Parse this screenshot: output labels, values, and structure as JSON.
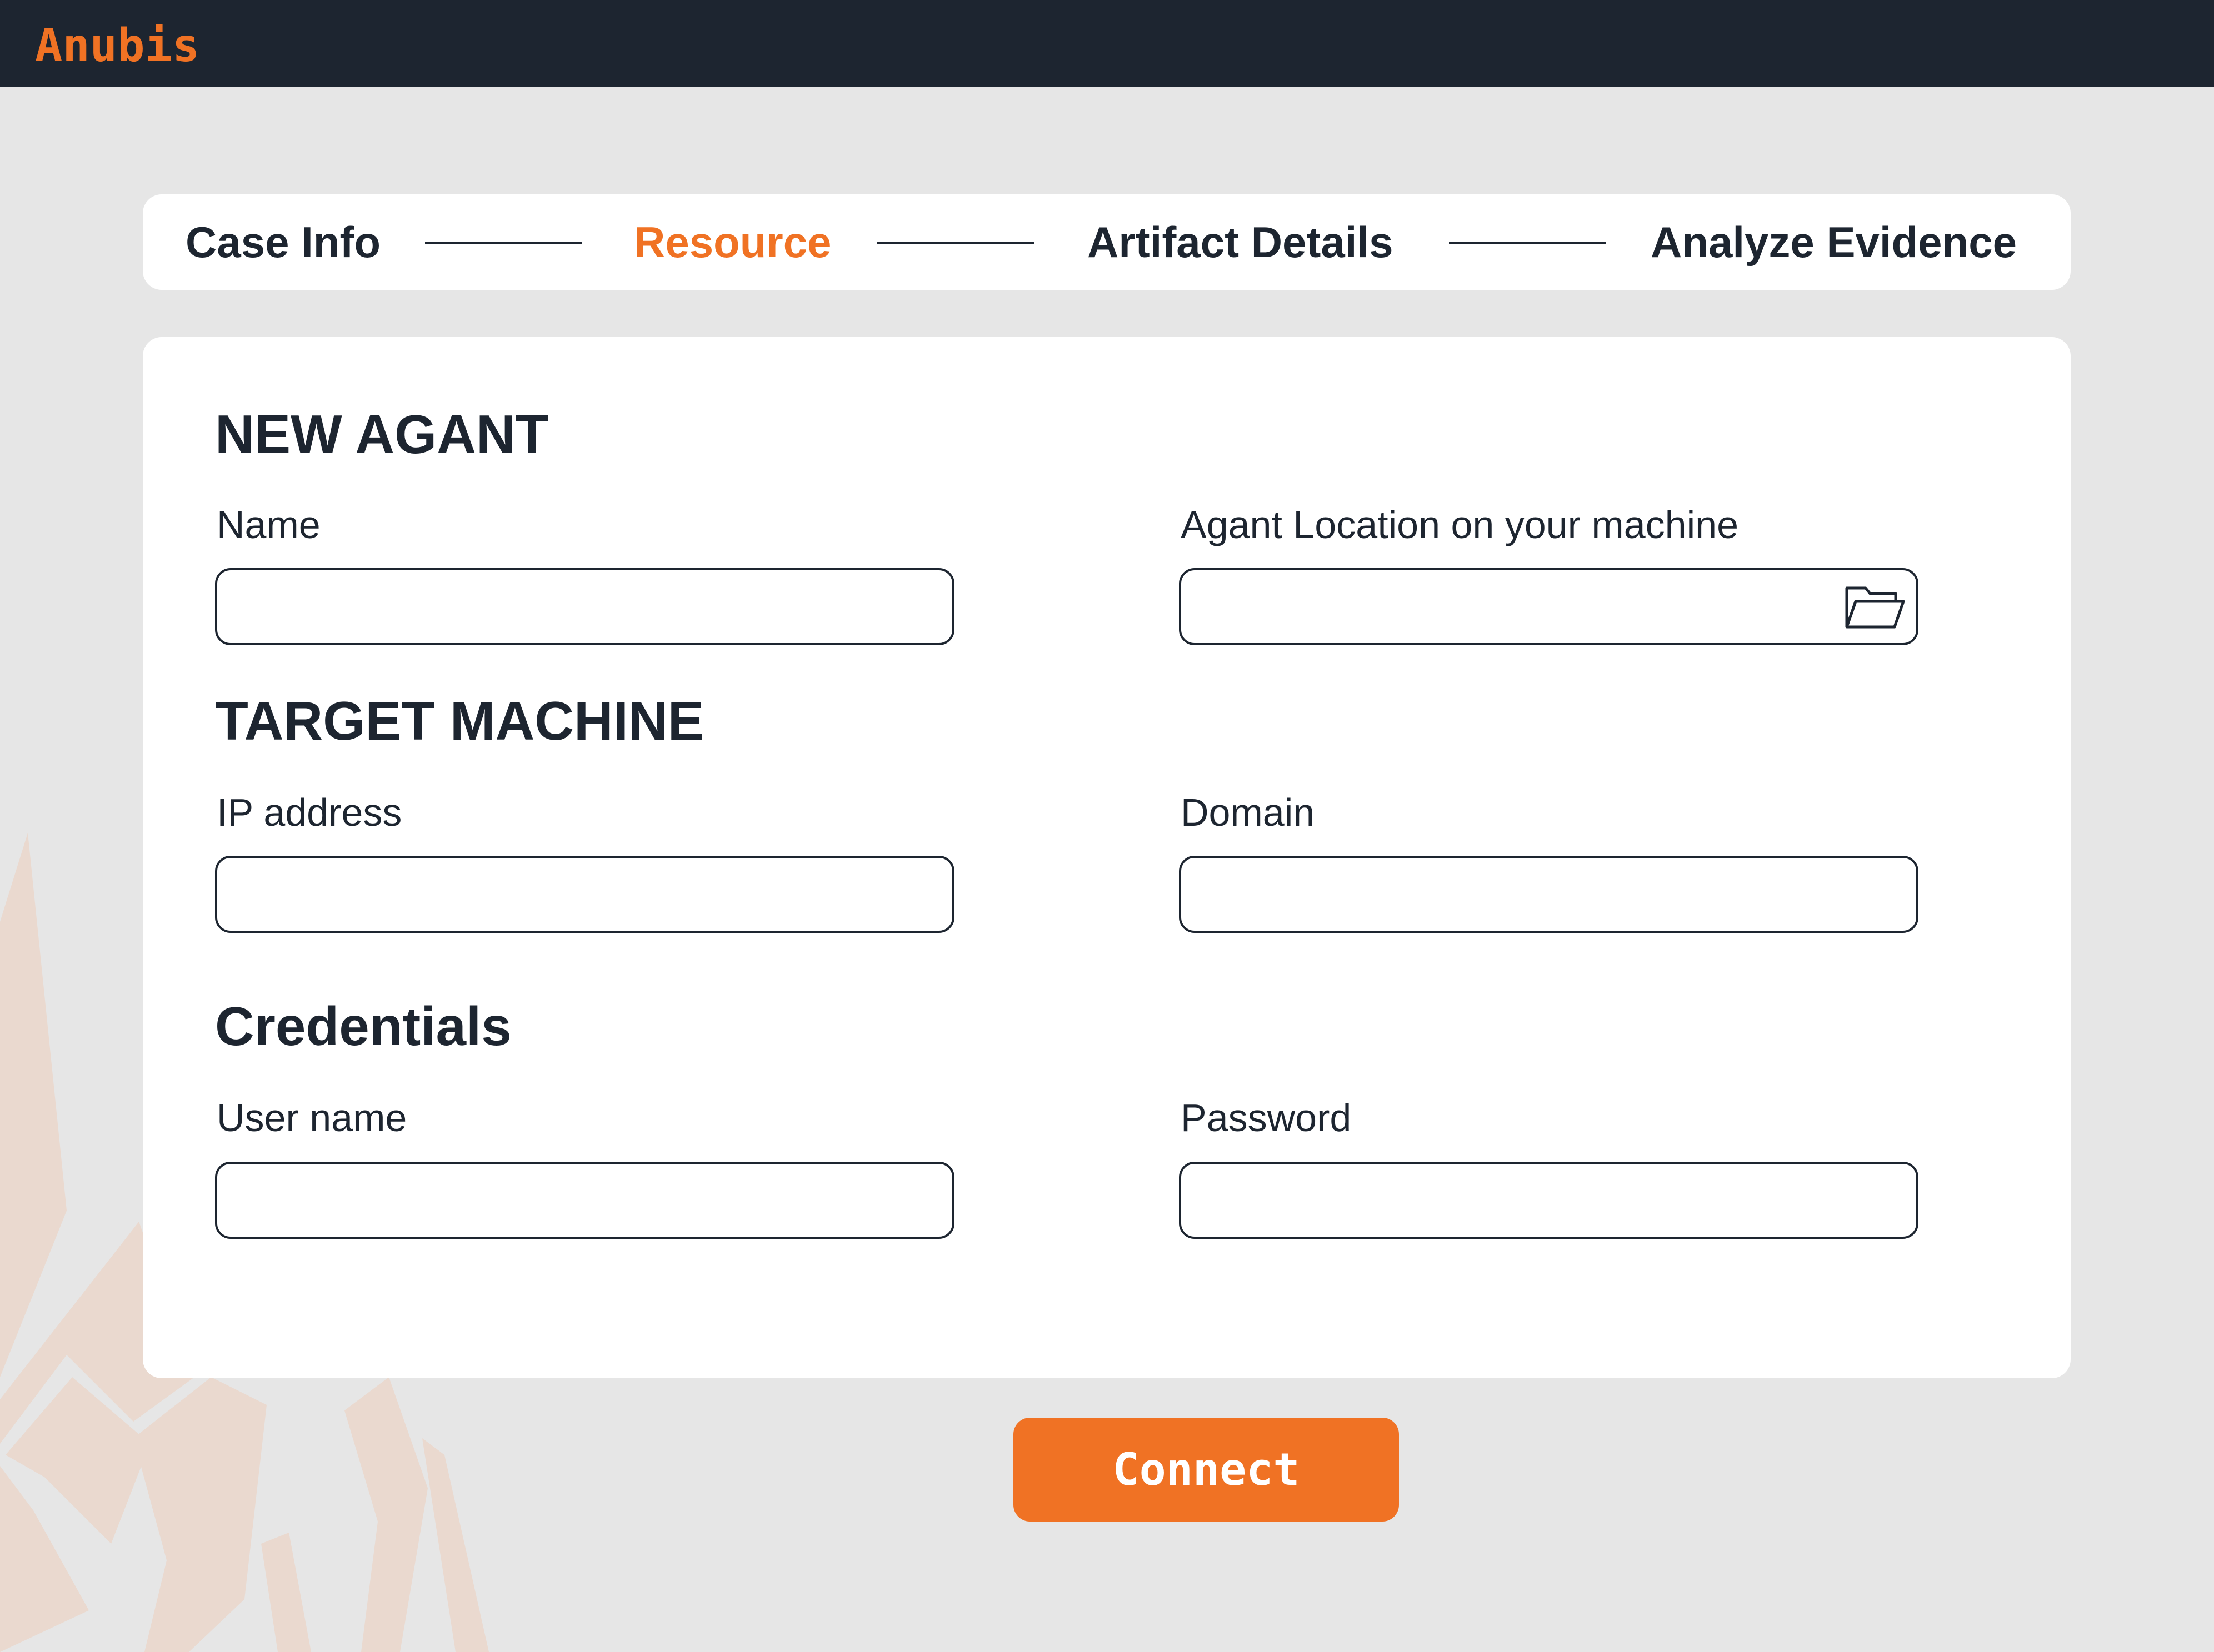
{
  "app": {
    "brand": "Anubis"
  },
  "stepper": {
    "steps": [
      {
        "label": "Case Info",
        "active": false
      },
      {
        "label": "Resource",
        "active": true
      },
      {
        "label": "Artifact Details",
        "active": false
      },
      {
        "label": "Analyze Evidence",
        "active": false
      }
    ]
  },
  "form": {
    "sections": {
      "new_agent": "NEW AGANT",
      "target_machine": "TARGET MACHINE",
      "credentials": "Credentials"
    },
    "fields": {
      "name": {
        "label": "Name",
        "value": "",
        "placeholder": ""
      },
      "agent_location": {
        "label": "Agant Location on your machine",
        "value": "",
        "placeholder": "",
        "icon": "folder-open-icon"
      },
      "ip_address": {
        "label": "IP address",
        "value": "",
        "placeholder": ""
      },
      "domain": {
        "label": "Domain",
        "value": "",
        "placeholder": ""
      },
      "user_name": {
        "label": "User name",
        "value": "",
        "placeholder": ""
      },
      "password": {
        "label": "Password",
        "value": "",
        "placeholder": ""
      }
    }
  },
  "actions": {
    "connect_label": "Connect"
  },
  "colors": {
    "accent": "#f07224",
    "dark": "#1d2530",
    "background": "#e6e6e6",
    "surface": "#ffffff",
    "watermark": "#ead9cf"
  }
}
